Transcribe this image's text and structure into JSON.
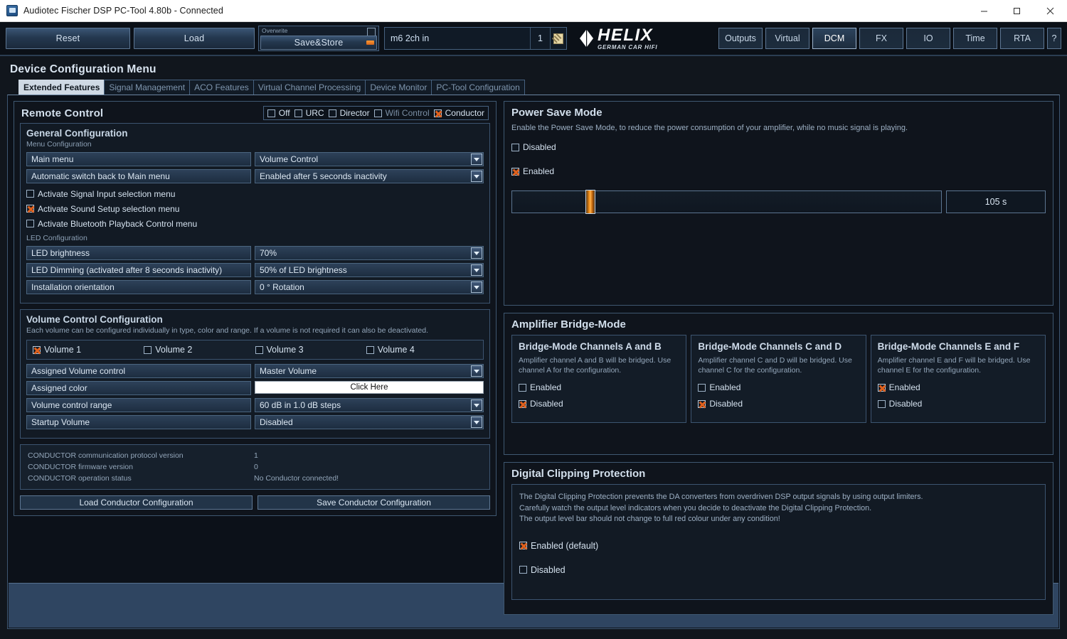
{
  "window": {
    "title": "Audiotec Fischer DSP PC-Tool 4.80b - Connected",
    "minimize": "–",
    "maximize": "□",
    "close": "✕"
  },
  "toolbar": {
    "reset": "Reset",
    "load": "Load",
    "overwrite_label": "Overwrite",
    "save_store": "Save&Store",
    "preset_name": "m6 2ch in",
    "preset_number": "1",
    "logo_text": "HELIX",
    "logo_sub": "GERMAN CAR HIFI",
    "nav": [
      {
        "label": "Outputs",
        "active": false
      },
      {
        "label": "Virtual",
        "active": false
      },
      {
        "label": "DCM",
        "active": true
      },
      {
        "label": "FX",
        "active": false
      },
      {
        "label": "IO",
        "active": false
      },
      {
        "label": "Time",
        "active": false
      },
      {
        "label": "RTA",
        "active": false
      },
      {
        "label": "?",
        "active": false
      }
    ]
  },
  "page": {
    "title": "Device Configuration Menu",
    "tabs": [
      {
        "label": "Extended Features",
        "active": true
      },
      {
        "label": "Signal Management",
        "active": false
      },
      {
        "label": "ACO Features",
        "active": false
      },
      {
        "label": "Virtual Channel Processing",
        "active": false
      },
      {
        "label": "Device Monitor",
        "active": false
      },
      {
        "label": "PC-Tool Configuration",
        "active": false
      }
    ]
  },
  "remote_control": {
    "title": "Remote Control",
    "modes": [
      {
        "label": "Off",
        "checked": false,
        "dim": false
      },
      {
        "label": "URC",
        "checked": false,
        "dim": false
      },
      {
        "label": "Director",
        "checked": false,
        "dim": false
      },
      {
        "label": "Wifi Control",
        "checked": false,
        "dim": true
      },
      {
        "label": "Conductor",
        "checked": true,
        "dim": false
      }
    ],
    "general": {
      "title": "General Configuration",
      "menu_config_label": "Menu Configuration",
      "rows": [
        {
          "label": "Main menu",
          "value": "Volume Control"
        },
        {
          "label": "Automatic switch back to Main menu",
          "value": "Enabled after 5 seconds inactivity"
        }
      ],
      "checkboxes": [
        {
          "label": "Activate Signal Input selection menu",
          "checked": false
        },
        {
          "label": "Activate Sound Setup selection menu",
          "checked": true
        },
        {
          "label": "Activate Bluetooth Playback Control menu",
          "checked": false
        }
      ],
      "led_config_label": "LED Configuration",
      "led_rows": [
        {
          "label": "LED brightness",
          "value": "70%"
        },
        {
          "label": "LED Dimming (activated after 8 seconds inactivity)",
          "value": "50% of LED brightness"
        },
        {
          "label": "Installation orientation",
          "value": "0 ° Rotation"
        }
      ]
    },
    "volume": {
      "title": "Volume Control Configuration",
      "note": "Each volume can be configured individually in type, color and range. If a volume is not required it can also be deactivated.",
      "tabs": [
        {
          "label": "Volume 1",
          "checked": true
        },
        {
          "label": "Volume 2",
          "checked": false
        },
        {
          "label": "Volume 3",
          "checked": false
        },
        {
          "label": "Volume 4",
          "checked": false
        }
      ],
      "rows": [
        {
          "label": "Assigned Volume control",
          "value": "Master Volume",
          "type": "dropdown"
        },
        {
          "label": "Assigned color",
          "value": "Click Here",
          "type": "color"
        },
        {
          "label": "Volume control range",
          "value": "60 dB in 1.0 dB steps",
          "type": "dropdown"
        },
        {
          "label": "Startup Volume",
          "value": "Disabled",
          "type": "dropdown"
        }
      ]
    },
    "status": [
      {
        "key": "CONDUCTOR communication protocol version",
        "value": "1"
      },
      {
        "key": "CONDUCTOR firmware version",
        "value": "0"
      },
      {
        "key": "CONDUCTOR operation status",
        "value": "No Conductor connected!"
      }
    ],
    "buttons": {
      "load": "Load Conductor Configuration",
      "save": "Save Conductor Configuration"
    }
  },
  "power_save": {
    "title": "Power Save Mode",
    "description": "Enable the Power Save Mode, to reduce the power consumption of your amplifier, while no music signal is playing.",
    "options": [
      {
        "label": "Disabled",
        "checked": false
      },
      {
        "label": "Enabled",
        "checked": true
      }
    ],
    "slider_value": "105 s",
    "slider_percent": 17
  },
  "bridge_mode": {
    "title": "Amplifier Bridge-Mode",
    "cards": [
      {
        "title": "Bridge-Mode Channels A and B",
        "desc": "Amplifier channel A and B will be bridged. Use channel A for the configuration.",
        "options": [
          {
            "label": "Enabled",
            "checked": false
          },
          {
            "label": "Disabled",
            "checked": true
          }
        ]
      },
      {
        "title": "Bridge-Mode Channels C and D",
        "desc": "Amplifier channel C and D will be bridged. Use channel C for the configuration.",
        "options": [
          {
            "label": "Enabled",
            "checked": false
          },
          {
            "label": "Disabled",
            "checked": true
          }
        ]
      },
      {
        "title": "Bridge-Mode Channels E and F",
        "desc": "Amplifier channel E and F will be bridged. Use channel E for the configuration.",
        "options": [
          {
            "label": "Enabled",
            "checked": true
          },
          {
            "label": "Disabled",
            "checked": false
          }
        ]
      }
    ]
  },
  "clipping": {
    "title": "Digital Clipping Protection",
    "desc_line1": "The Digital Clipping Protection prevents the DA converters from overdriven DSP output signals by using output limiters.",
    "desc_line2": "Carefully watch the output level indicators when you decide to deactivate the Digital Clipping Protection.",
    "desc_line3": "The output level bar should not change to full red colour under any condition!",
    "options": [
      {
        "label": "Enabled (default)",
        "checked": true
      },
      {
        "label": "Disabled",
        "checked": false
      }
    ]
  },
  "colors": {
    "accent": "#e0601c",
    "panel_bg": "#0f141c",
    "field_bg": "#24384f",
    "border": "#3f5871"
  }
}
